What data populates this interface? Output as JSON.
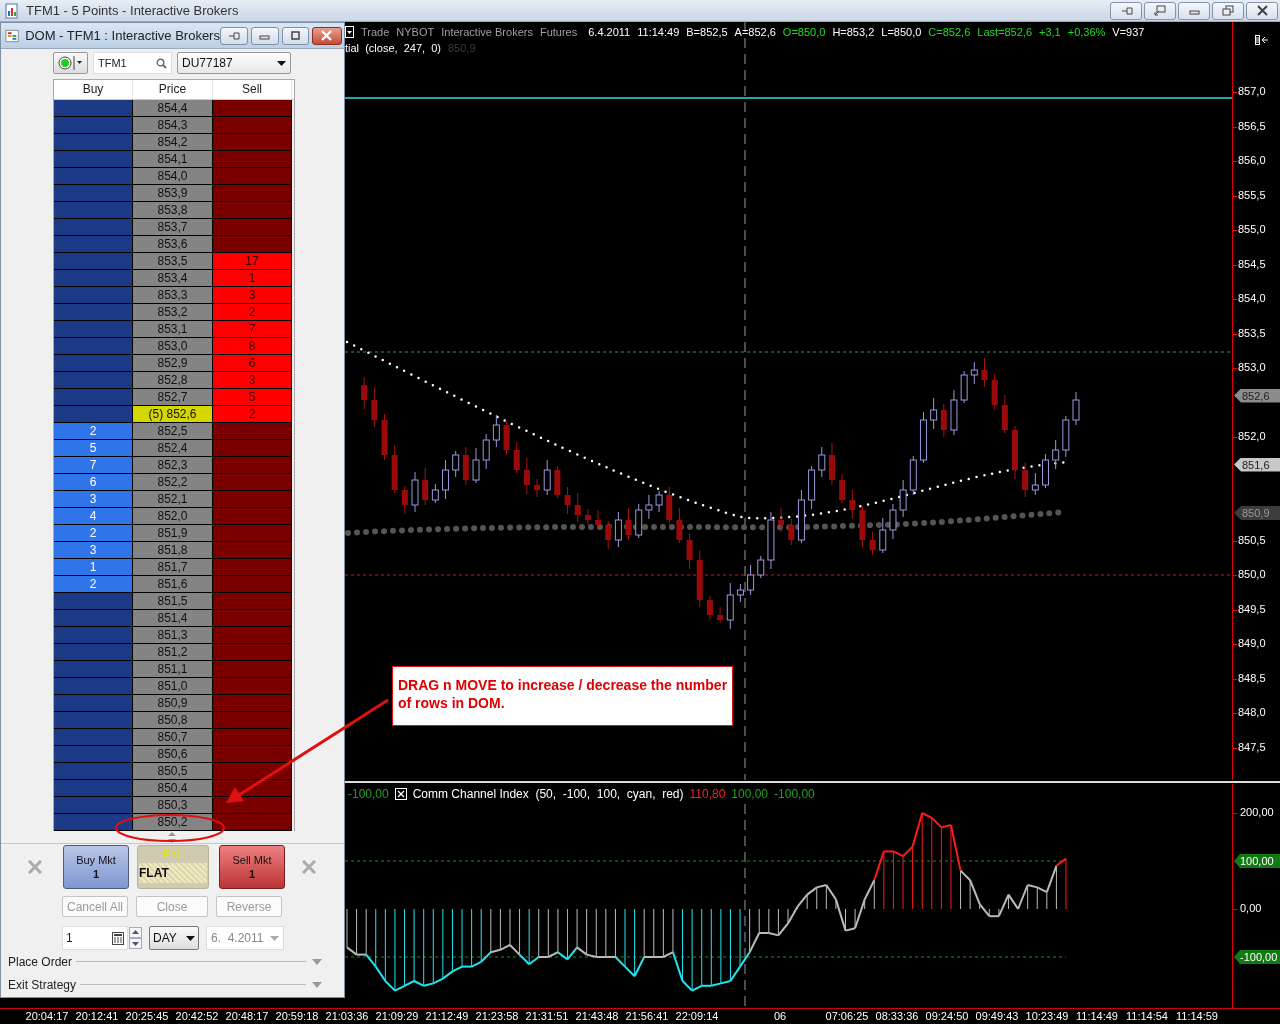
{
  "window": {
    "title": "TFM1 - 5 Points - Interactive Brokers"
  },
  "dom": {
    "title": "DOM - TFM1 : Interactive Brokers",
    "connected": true,
    "symbol": "TFM1",
    "account": "DU77187",
    "columns": [
      "Buy",
      "Price",
      "Sell"
    ],
    "rows": [
      {
        "price": "854,4",
        "current": false
      },
      {
        "price": "854,3",
        "current": false
      },
      {
        "price": "854,2",
        "current": false
      },
      {
        "price": "854,1",
        "current": false
      },
      {
        "price": "854,0",
        "current": false
      },
      {
        "price": "853,9",
        "current": false
      },
      {
        "price": "853,8",
        "current": false
      },
      {
        "price": "853,7",
        "current": false
      },
      {
        "price": "853,6",
        "current": false
      },
      {
        "price": "853,5",
        "sell": "17",
        "current": false
      },
      {
        "price": "853,4",
        "sell": "1",
        "current": false
      },
      {
        "price": "853,3",
        "sell": "3",
        "current": false
      },
      {
        "price": "853,2",
        "sell": "2",
        "current": false
      },
      {
        "price": "853,1",
        "sell": "7",
        "current": false
      },
      {
        "price": "853,0",
        "sell": "8",
        "current": false
      },
      {
        "price": "852,9",
        "sell": "6",
        "current": false
      },
      {
        "price": "852,8",
        "sell": "3",
        "current": false
      },
      {
        "price": "852,7",
        "sell": "5",
        "current": false
      },
      {
        "price": "(5) 852,6",
        "sell": "2",
        "current": true
      },
      {
        "price": "852,5",
        "buy": "2",
        "current": false
      },
      {
        "price": "852,4",
        "buy": "5",
        "current": false
      },
      {
        "price": "852,3",
        "buy": "7",
        "current": false
      },
      {
        "price": "852,2",
        "buy": "6",
        "current": false
      },
      {
        "price": "852,1",
        "buy": "3",
        "current": false
      },
      {
        "price": "852,0",
        "buy": "4",
        "current": false
      },
      {
        "price": "851,9",
        "buy": "2",
        "current": false
      },
      {
        "price": "851,8",
        "buy": "3",
        "current": false
      },
      {
        "price": "851,7",
        "buy": "1",
        "current": false
      },
      {
        "price": "851,6",
        "buy": "2",
        "current": false
      },
      {
        "price": "851,5",
        "current": false
      },
      {
        "price": "851,4",
        "current": false
      },
      {
        "price": "851,3",
        "current": false
      },
      {
        "price": "851,2",
        "current": false
      },
      {
        "price": "851,1",
        "current": false
      },
      {
        "price": "851,0",
        "current": false
      },
      {
        "price": "850,9",
        "current": false
      },
      {
        "price": "850,8",
        "current": false
      },
      {
        "price": "850,7",
        "current": false
      },
      {
        "price": "850,6",
        "current": false
      },
      {
        "price": "850,5",
        "current": false
      },
      {
        "price": "850,4",
        "current": false
      },
      {
        "price": "850,3",
        "current": false
      },
      {
        "price": "850,2",
        "current": false
      }
    ],
    "order_buttons": [
      {
        "kind": "buy",
        "label": "Buy Mkt",
        "quantity": "1"
      },
      {
        "kind": "pnl",
        "label": "PnL",
        "value": "FLAT"
      },
      {
        "kind": "sell",
        "label": "Sell Mkt",
        "quantity": "1"
      }
    ],
    "actions": [
      {
        "label": "Cancell All",
        "disabled": true
      },
      {
        "label": "Close",
        "disabled": true
      },
      {
        "label": "Reverse",
        "disabled": true
      }
    ],
    "quantity": "1",
    "time_in_force": "DAY",
    "date": {
      "value": "6.  4.2011",
      "disabled": true
    },
    "sections": [
      {
        "label": "Place Order",
        "expanded": false
      },
      {
        "label": "Exit Strategy",
        "expanded": false
      }
    ]
  },
  "chart": {
    "header": [
      {
        "text": "Trade",
        "color": "#a0a0a0"
      },
      {
        "text": "NYBOT",
        "color": "#a0a0a0"
      },
      {
        "text": "Interactive Brokers",
        "color": "#a0a0a0"
      },
      {
        "text": "Futures",
        "color": "#a0a0a0"
      },
      {
        "text": "6.4.2011",
        "color": "#ffffff"
      },
      {
        "text": "11:14:49",
        "color": "#ffffff"
      },
      {
        "text": "B=852,5",
        "color": "#ffffff"
      },
      {
        "text": "A=852,6",
        "color": "#ffffff"
      },
      {
        "text": "O=850,0",
        "color": "#22dd22"
      },
      {
        "text": "H=853,2",
        "color": "#ffffff"
      },
      {
        "text": "L=850,0",
        "color": "#ffffff"
      },
      {
        "text": "C=852,6",
        "color": "#22dd22"
      },
      {
        "text": "Last=852,6",
        "color": "#22dd22"
      },
      {
        "text": "+3,1",
        "color": "#22dd22"
      },
      {
        "text": "+0,36%",
        "color": "#22dd22"
      },
      {
        "text": "V=937",
        "color": "#ffffff"
      }
    ],
    "study": [
      {
        "text": "tial  (close,  247,  0)",
        "color": "#ffffff"
      },
      {
        "text": "850,9",
        "color": "#3a3a3a"
      }
    ],
    "price_axis": [
      "857,0",
      "856,5",
      "856,0",
      "855,5",
      "855,0",
      "854,5",
      "854,0",
      "853,5",
      "853,0",
      "852,0",
      "850,5",
      "850,0",
      "849,5",
      "849,0",
      "848,5",
      "848,0",
      "847,5"
    ],
    "price_markers": [
      {
        "text": "852,6",
        "color": "#8c8c8c"
      },
      {
        "text": "851,6",
        "color": "#c8c8c8"
      },
      {
        "text": "850,9",
        "color": "#3c3c3c"
      }
    ]
  },
  "cci": {
    "lead": {
      "text": "-100,00",
      "color": "#1fa01f"
    },
    "title": "Comm Channel Index  (50,  -100,  100,  cyan,  red)",
    "values": [
      {
        "text": "110,80",
        "color": "#ff2020"
      },
      {
        "text": "100,00",
        "color": "#1fa01f"
      },
      {
        "text": "-100,00",
        "color": "#1fa01f"
      }
    ],
    "axis": [
      "200,00",
      "0,00"
    ],
    "markers": [
      {
        "text": "100,00",
        "color": "#137a13"
      },
      {
        "text": "-100,00",
        "color": "#137a13"
      }
    ]
  },
  "time_axis": [
    "20:04:17",
    "20:12:41",
    "20:25:45",
    "20:42:52",
    "20:48:17",
    "20:59:18",
    "21:03:36",
    "21:09:29",
    "21:12:49",
    "21:23:58",
    "21:31:51",
    "21:43:48",
    "21:56:41",
    "22:09:14",
    "06",
    "07:06:25",
    "08:33:36",
    "09:24:50",
    "09:49:43",
    "10:23:49",
    "11:14:49",
    "11:14:54",
    "11:14:59"
  ],
  "annotation": {
    "text": "DRAG n MOVE to increase / decrease the number of rows in DOM."
  }
}
